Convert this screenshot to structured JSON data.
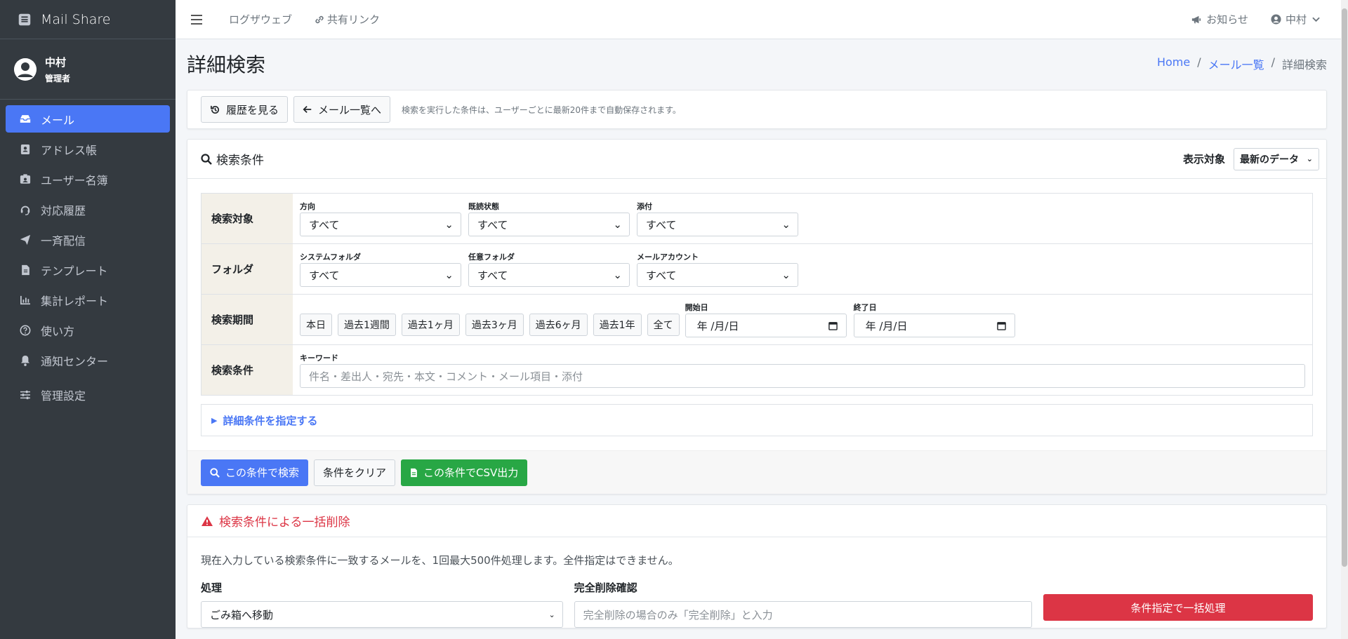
{
  "app": {
    "name": "Mail Share"
  },
  "user": {
    "name": "中村",
    "role": "管理者"
  },
  "sidebar": {
    "items": [
      {
        "label": "メール",
        "icon": "inbox-icon",
        "active": true
      },
      {
        "label": "アドレス帳",
        "icon": "address-book-icon"
      },
      {
        "label": "ユーザー名簿",
        "icon": "id-badge-icon"
      },
      {
        "label": "対応履歴",
        "icon": "headset-icon"
      },
      {
        "label": "一斉配信",
        "icon": "paper-plane-icon"
      },
      {
        "label": "テンプレート",
        "icon": "file-icon"
      },
      {
        "label": "集計レポート",
        "icon": "chart-bar-icon"
      },
      {
        "label": "使い方",
        "icon": "question-circle-icon"
      },
      {
        "label": "通知センター",
        "icon": "bell-icon"
      },
      {
        "label": "管理設定",
        "icon": "sliders-icon"
      }
    ]
  },
  "topbar": {
    "links": [
      "ログザウェブ",
      "共有リンク"
    ],
    "notice": "お知らせ",
    "user": "中村"
  },
  "page": {
    "title": "詳細検索",
    "breadcrumb": [
      "Home",
      "メール一覧",
      "詳細検索"
    ]
  },
  "toolbar": {
    "history_btn": "履歴を見る",
    "back_btn": "メール一覧へ",
    "hint": "検索を実行した条件は、ユーザーごとに最新20件まで自動保存されます。"
  },
  "search": {
    "title": "検索条件",
    "display_target_label": "表示対象",
    "display_target_value": "最新のデータ",
    "rows": {
      "target": {
        "head": "検索対象",
        "fields": [
          {
            "label": "方向",
            "value": "すべて"
          },
          {
            "label": "既読状態",
            "value": "すべて"
          },
          {
            "label": "添付",
            "value": "すべて"
          }
        ]
      },
      "folder": {
        "head": "フォルダ",
        "fields": [
          {
            "label": "システムフォルダ",
            "value": "すべて"
          },
          {
            "label": "任意フォルダ",
            "value": "すべて"
          },
          {
            "label": "メールアカウント",
            "value": "すべて"
          }
        ]
      },
      "period": {
        "head": "検索期間",
        "presets": [
          "本日",
          "過去1週間",
          "過去1ヶ月",
          "過去3ヶ月",
          "過去6ヶ月",
          "過去1年",
          "全て"
        ],
        "start_label": "開始日",
        "end_label": "終了日",
        "date_placeholder": "年 /月/日"
      },
      "condition": {
        "head": "検索条件",
        "keyword_label": "キーワード",
        "keyword_placeholder": "件名・差出人・宛先・本文・コメント・メール項目・添付"
      }
    },
    "details_toggle": "詳細条件を指定する",
    "search_btn": "この条件で検索",
    "clear_btn": "条件をクリア",
    "csv_btn": "この条件でCSV出力"
  },
  "bulk_delete": {
    "title": "検索条件による一括削除",
    "description": "現在入力している検索条件に一致するメールを、1回最大500件処理します。全件指定はできません。",
    "action_label": "処理",
    "action_value": "ごみ箱へ移動",
    "confirm_label": "完全削除確認",
    "confirm_placeholder": "完全削除の場合のみ「完全削除」と入力",
    "submit_btn": "条件指定で一括処理"
  },
  "colors": {
    "sidebar_bg": "#343a40",
    "accent": "#4a77f5",
    "success": "#28a745",
    "danger": "#dc3545"
  }
}
